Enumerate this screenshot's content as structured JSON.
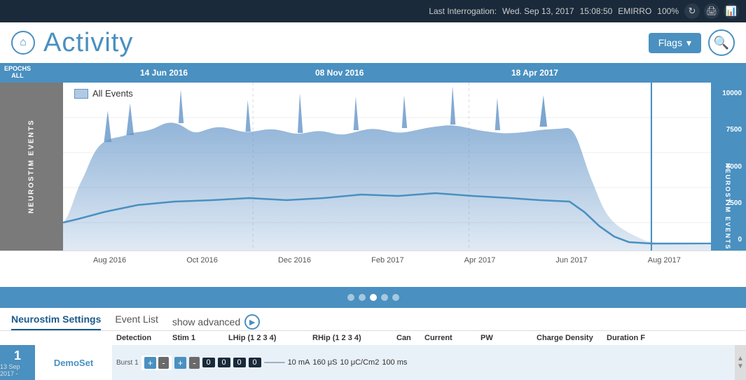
{
  "topbar": {
    "last_interrogation_label": "Last Interrogation:",
    "date": "Wed. Sep 13, 2017",
    "time": "15:08:50",
    "patient_id": "EMIRRO",
    "battery": "100%"
  },
  "header": {
    "title": "Activity",
    "flags_label": "Flags",
    "home_icon": "⌂",
    "search_icon": "🔍"
  },
  "timeline": {
    "epochs_label": "EPOCHS",
    "epochs_sub": "ALL",
    "dates": [
      "14 Jun 2016",
      "08 Nov 2016",
      "18 Apr 2017"
    ]
  },
  "chart": {
    "y_axis_label": "NEUROSTIM EVENTS",
    "y_ticks_right": [
      "10000",
      "7500",
      "5000",
      "2500",
      "0"
    ],
    "legend_label": "All Events",
    "x_ticks": [
      "Aug 2016",
      "Oct 2016",
      "Dec 2016",
      "Feb 2017",
      "Apr 2017",
      "Jun 2017",
      "Aug 2017"
    ]
  },
  "dots": [
    1,
    2,
    3,
    4,
    5
  ],
  "active_dot": 2,
  "tabs": {
    "items": [
      {
        "label": "Neurostim Settings",
        "active": true
      },
      {
        "label": "Event List",
        "active": false
      }
    ],
    "show_advanced_label": "show advanced"
  },
  "table": {
    "headers": [
      "Detection",
      "Stim 1",
      "LHip (1 2 3 4)",
      "",
      "RHip (1 2 3 4)",
      "",
      "Can",
      "Current",
      "PW",
      "Charge Density",
      "Duration F"
    ],
    "rows": [
      {
        "number": "1",
        "date": "13 Sep 2017 -",
        "detection": "DemoSet",
        "burst_label": "Burst 1",
        "vals": [
          "0",
          "0",
          "0",
          "0"
        ],
        "current": "10 mA",
        "pw": "160 μS",
        "charge_density": "10 μC/Cm2",
        "duration": "100 ms"
      }
    ]
  }
}
